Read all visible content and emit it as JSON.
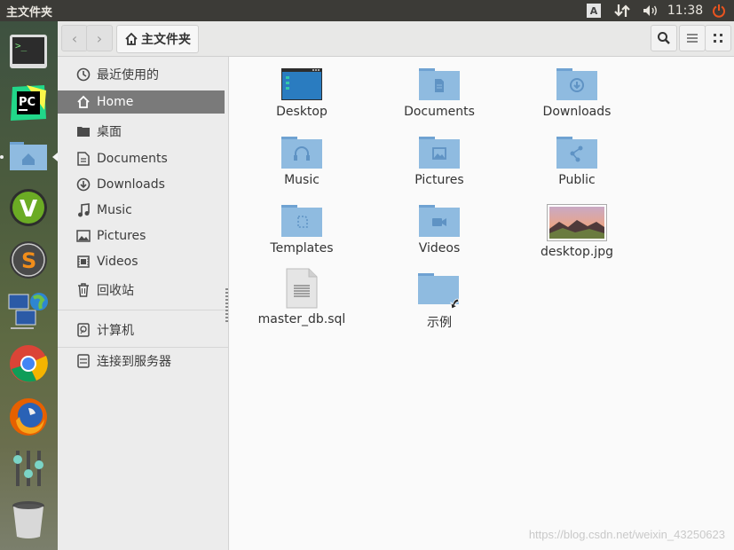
{
  "topbar": {
    "title": "主文件夹",
    "keyboard_indicator": "A",
    "time": "11:38"
  },
  "breadcrumb": {
    "label": "主文件夹"
  },
  "sidebar": {
    "items": [
      {
        "label": "最近使用的",
        "icon": "clock-icon"
      },
      {
        "label": "Home",
        "icon": "home-icon",
        "active": true
      },
      {
        "label": "桌面",
        "icon": "folder-icon"
      },
      {
        "label": "Documents",
        "icon": "document-icon"
      },
      {
        "label": "Downloads",
        "icon": "download-icon"
      },
      {
        "label": "Music",
        "icon": "music-icon"
      },
      {
        "label": "Pictures",
        "icon": "picture-icon"
      },
      {
        "label": "Videos",
        "icon": "video-icon"
      },
      {
        "label": "回收站",
        "icon": "trash-icon"
      },
      {
        "label": "计算机",
        "icon": "computer-icon"
      },
      {
        "label": "连接到服务器",
        "icon": "server-icon"
      }
    ]
  },
  "files": [
    {
      "name": "Desktop",
      "type": "desktop-folder"
    },
    {
      "name": "Documents",
      "type": "folder-documents"
    },
    {
      "name": "Downloads",
      "type": "folder-downloads"
    },
    {
      "name": "Music",
      "type": "folder-music"
    },
    {
      "name": "Pictures",
      "type": "folder-pictures"
    },
    {
      "name": "Public",
      "type": "folder-public"
    },
    {
      "name": "Templates",
      "type": "folder-templates"
    },
    {
      "name": "Videos",
      "type": "folder-videos"
    },
    {
      "name": "desktop.jpg",
      "type": "image"
    },
    {
      "name": "master_db.sql",
      "type": "text-file"
    },
    {
      "name": "示例",
      "type": "folder-link"
    }
  ],
  "watermark": "https://blog.csdn.net/weixin_43250623",
  "colors": {
    "folder": "#8fbbe0",
    "folder_dark": "#5f93c4",
    "accent": "#e95420",
    "sidebar_active": "#7a7a7a"
  }
}
